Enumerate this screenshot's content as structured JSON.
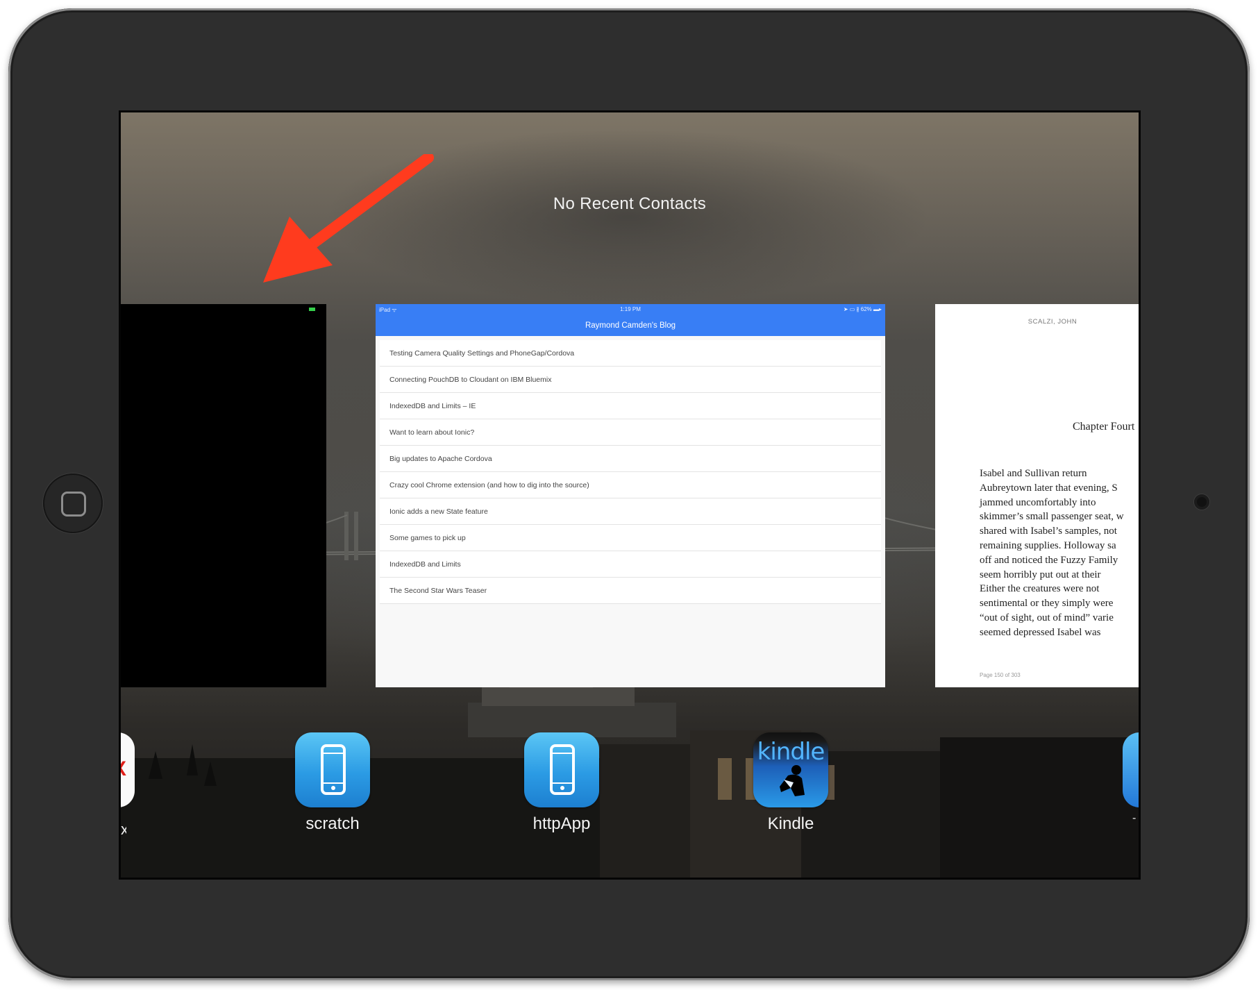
{
  "device": {
    "home_button_icon": "home-button-icon"
  },
  "screen": {
    "no_contacts_label": "No Recent Contacts"
  },
  "annotation": {
    "arrow_color": "#ff3b1e"
  },
  "cards": {
    "blog": {
      "status_left": "iPad ᯤ",
      "status_time": "1:19 PM",
      "status_right": "➤ ▭ ∦ 62% ▬▸",
      "title": "Raymond Camden's Blog",
      "accent_color": "#387ef5",
      "posts": [
        "Testing Camera Quality Settings and PhoneGap/Cordova",
        "Connecting PouchDB to Cloudant on IBM Bluemix",
        "IndexedDB and Limits – IE",
        "Want to learn about Ionic?",
        "Big updates to Apache Cordova",
        "Crazy cool Chrome extension (and how to dig into the source)",
        "Ionic adds a new State feature",
        "Some games to pick up",
        "IndexedDB and Limits",
        "The Second Star Wars Teaser"
      ]
    },
    "book": {
      "author": "SCALZI, JOHN",
      "chapter": "Chapter Fourt",
      "lines": [
        "Isabel    and    Sullivan    return",
        "Aubreytown later that evening, S",
        "jammed      uncomfortably      into",
        "skimmer’s small passenger seat, w",
        "shared with Isabel’s samples, not",
        "remaining supplies. Holloway sa",
        "off and noticed the Fuzzy Family",
        "seem horribly put out at their",
        "Either  the  creatures  were  not",
        "sentimental  or  they  simply  were",
        "“out of sight, out of mind” varie",
        "seemed    depressed    Isabel    was"
      ],
      "page_info": "Page 150 of 303"
    }
  },
  "apps": [
    {
      "label": "scratch",
      "icon": "phone-app-icon"
    },
    {
      "label": "httpApp",
      "icon": "phone-app-icon"
    },
    {
      "label": "Kindle",
      "icon": "kindle-icon",
      "icon_text": "kindle"
    }
  ],
  "partial": {
    "left_glyph": "X",
    "left_label": "x",
    "right_label": "-"
  }
}
